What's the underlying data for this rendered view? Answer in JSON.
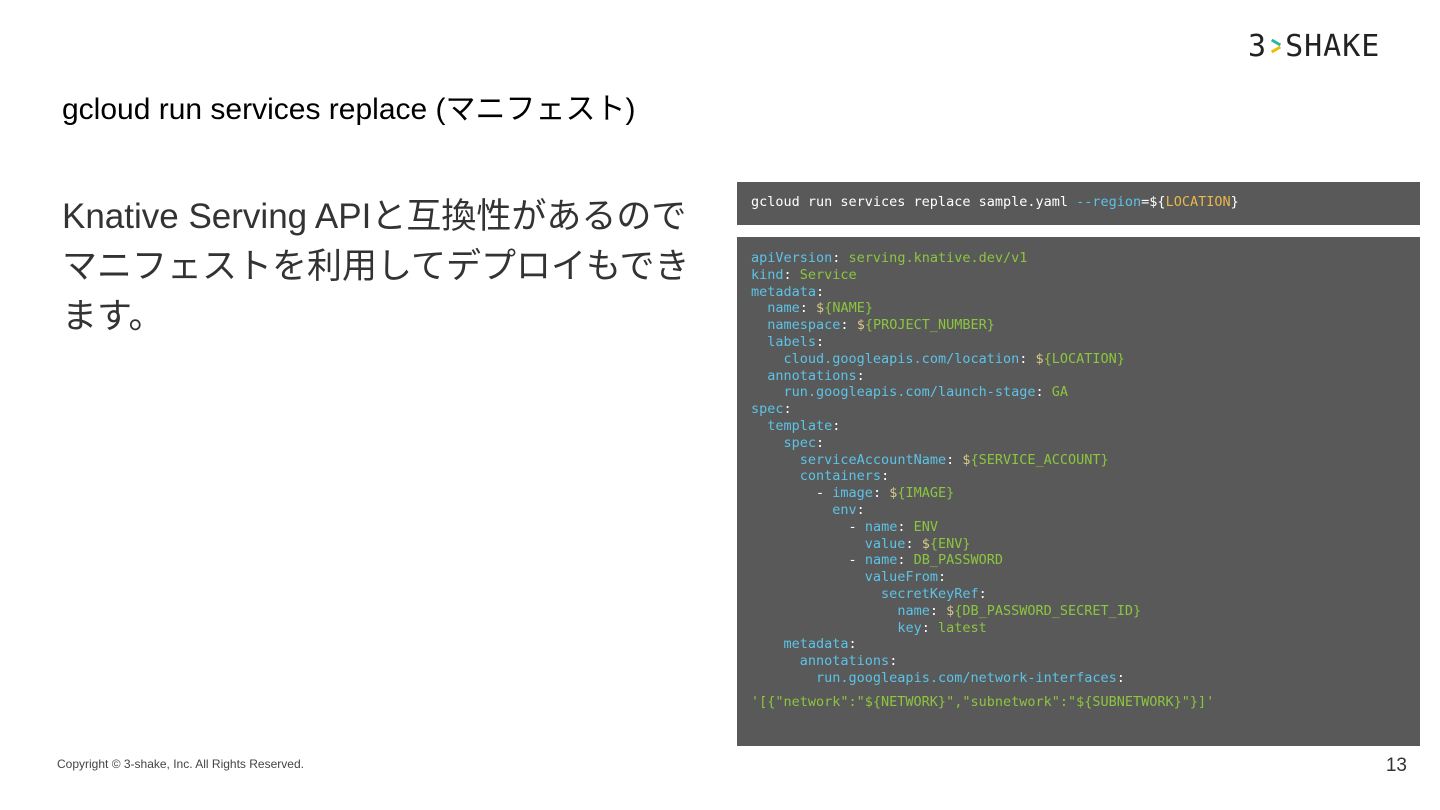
{
  "logo": {
    "left": "3",
    "right": "SHAKE"
  },
  "title": "gcloud run services replace (マニフェスト)",
  "body": "Knative Serving APIと互換性があるのでマニフェストを利用してデプロイもできます。",
  "command": {
    "base": "gcloud run services replace sample.yaml ",
    "flag": "--region",
    "eq": "=",
    "dollar": "$",
    "open": "{",
    "var": "LOCATION",
    "close": "}"
  },
  "yaml": [
    {
      "indent": "",
      "dash": "",
      "key": "apiVersion",
      "sep": ": ",
      "dollar": "",
      "value": "serving.knative.dev/v1"
    },
    {
      "indent": "",
      "dash": "",
      "key": "kind",
      "sep": ": ",
      "dollar": "",
      "value": "Service"
    },
    {
      "indent": "",
      "dash": "",
      "key": "metadata",
      "sep": ":",
      "dollar": "",
      "value": ""
    },
    {
      "indent": "  ",
      "dash": "",
      "key": "name",
      "sep": ": ",
      "dollar": "$",
      "value": "{NAME}"
    },
    {
      "indent": "  ",
      "dash": "",
      "key": "namespace",
      "sep": ": ",
      "dollar": "$",
      "value": "{PROJECT_NUMBER}"
    },
    {
      "indent": "  ",
      "dash": "",
      "key": "labels",
      "sep": ":",
      "dollar": "",
      "value": ""
    },
    {
      "indent": "    ",
      "dash": "",
      "key": "cloud.googleapis.com/location",
      "sep": ": ",
      "dollar": "$",
      "value": "{LOCATION}"
    },
    {
      "indent": "  ",
      "dash": "",
      "key": "annotations",
      "sep": ":",
      "dollar": "",
      "value": ""
    },
    {
      "indent": "    ",
      "dash": "",
      "key": "run.googleapis.com/launch-stage",
      "sep": ": ",
      "dollar": "",
      "value": "GA"
    },
    {
      "indent": "",
      "dash": "",
      "key": "spec",
      "sep": ":",
      "dollar": "",
      "value": ""
    },
    {
      "indent": "  ",
      "dash": "",
      "key": "template",
      "sep": ":",
      "dollar": "",
      "value": ""
    },
    {
      "indent": "    ",
      "dash": "",
      "key": "spec",
      "sep": ":",
      "dollar": "",
      "value": ""
    },
    {
      "indent": "      ",
      "dash": "",
      "key": "serviceAccountName",
      "sep": ": ",
      "dollar": "$",
      "value": "{SERVICE_ACCOUNT}"
    },
    {
      "indent": "      ",
      "dash": "",
      "key": "containers",
      "sep": ":",
      "dollar": "",
      "value": ""
    },
    {
      "indent": "        ",
      "dash": "- ",
      "key": "image",
      "sep": ": ",
      "dollar": "$",
      "value": "{IMAGE}"
    },
    {
      "indent": "          ",
      "dash": "",
      "key": "env",
      "sep": ":",
      "dollar": "",
      "value": ""
    },
    {
      "indent": "            ",
      "dash": "- ",
      "key": "name",
      "sep": ": ",
      "dollar": "",
      "value": "ENV"
    },
    {
      "indent": "              ",
      "dash": "",
      "key": "value",
      "sep": ": ",
      "dollar": "$",
      "value": "{ENV}"
    },
    {
      "indent": "            ",
      "dash": "- ",
      "key": "name",
      "sep": ": ",
      "dollar": "",
      "value": "DB_PASSWORD"
    },
    {
      "indent": "              ",
      "dash": "",
      "key": "valueFrom",
      "sep": ":",
      "dollar": "",
      "value": ""
    },
    {
      "indent": "                ",
      "dash": "",
      "key": "secretKeyRef",
      "sep": ":",
      "dollar": "",
      "value": ""
    },
    {
      "indent": "                  ",
      "dash": "",
      "key": "name",
      "sep": ": ",
      "dollar": "$",
      "value": "{DB_PASSWORD_SECRET_ID}"
    },
    {
      "indent": "                  ",
      "dash": "",
      "key": "key",
      "sep": ": ",
      "dollar": "",
      "value": "latest"
    },
    {
      "indent": "    ",
      "dash": "",
      "key": "metadata",
      "sep": ":",
      "dollar": "",
      "value": ""
    },
    {
      "indent": "      ",
      "dash": "",
      "key": "annotations",
      "sep": ":",
      "dollar": "",
      "value": ""
    },
    {
      "indent": "        ",
      "dash": "",
      "key": "run.googleapis.com/network-interfaces",
      "sep": ":",
      "dollar": "",
      "value": ""
    }
  ],
  "yaml_tail": "'[{\"network\":\"${NETWORK}\",\"subnetwork\":\"${SUBNETWORK}\"}]'",
  "footer": "Copyright © 3-shake, Inc. All Rights Reserved.",
  "page_number": "13"
}
